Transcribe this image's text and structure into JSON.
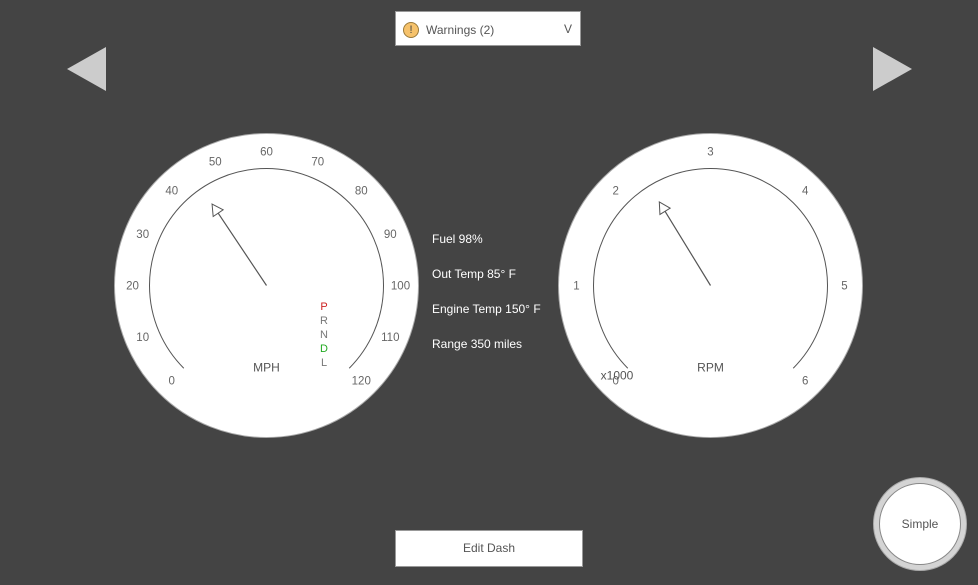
{
  "warnings": {
    "icon": "warning-icon",
    "icon_glyph": "!",
    "label": "Warnings (2)",
    "toggle": "V"
  },
  "navigation": {
    "prev_icon": "left-arrow-icon",
    "next_icon": "right-arrow-icon"
  },
  "speedometer": {
    "unit": "MPH",
    "value_mph": 45,
    "ticks": [
      "0",
      "10",
      "20",
      "30",
      "40",
      "50",
      "60",
      "70",
      "80",
      "90",
      "100",
      "110",
      "120"
    ],
    "gear_indicator": [
      {
        "label": "P",
        "color": "#cc2222"
      },
      {
        "label": "R",
        "color": "#777777"
      },
      {
        "label": "N",
        "color": "#777777"
      },
      {
        "label": "D",
        "color": "#22aa22"
      },
      {
        "label": "L",
        "color": "#777777"
      }
    ]
  },
  "tachometer": {
    "unit": "RPM",
    "multiplier": "x1000",
    "value_krpm": 2.3,
    "ticks": [
      "0",
      "1",
      "2",
      "3",
      "4",
      "5",
      "6"
    ]
  },
  "info": {
    "fuel": "Fuel 98%",
    "out_temp": "Out Temp 85° F",
    "engine_temp": "Engine Temp 150° F",
    "range": "Range 350 miles"
  },
  "buttons": {
    "edit_dash": "Edit Dash",
    "simple": "Simple"
  },
  "colors": {
    "background": "#444444",
    "gauge_face": "#ffffff",
    "warning_icon": "#f6c26b",
    "nav_arrow": "#cccccc"
  }
}
